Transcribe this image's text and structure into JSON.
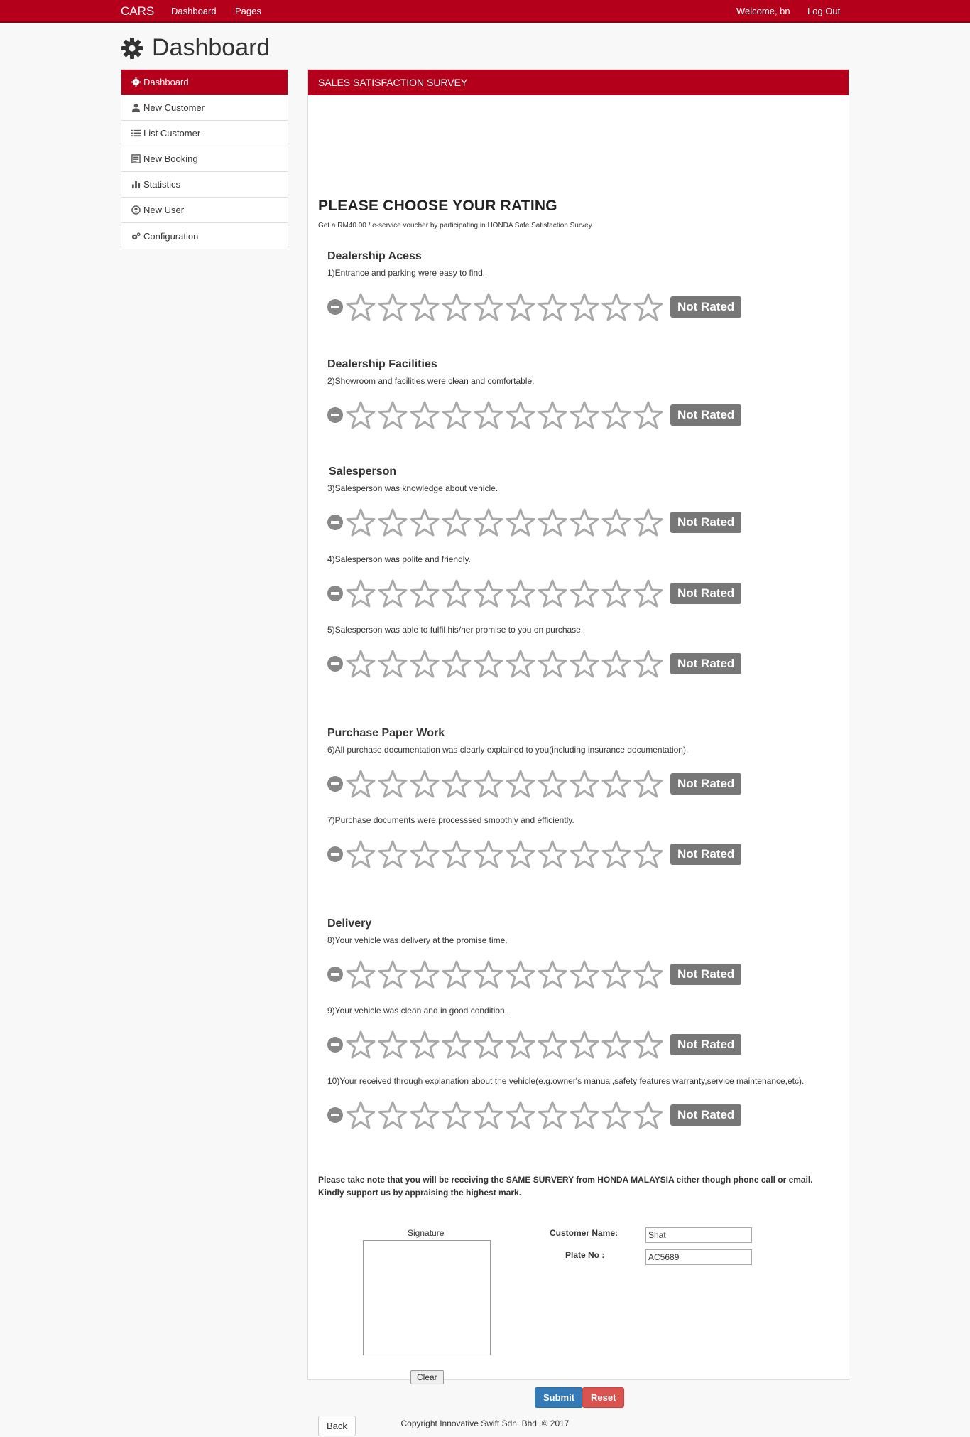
{
  "topbar": {
    "brand": "CARS",
    "nav_dashboard": "Dashboard",
    "nav_pages": "Pages",
    "welcome": "Welcome, bn",
    "logout": "Log Out"
  },
  "page_title": "Dashboard",
  "sidebar": {
    "items": [
      {
        "label": "Dashboard",
        "icon": "gear-icon"
      },
      {
        "label": "New Customer",
        "icon": "user-icon"
      },
      {
        "label": "List Customer",
        "icon": "list-icon"
      },
      {
        "label": "New Booking",
        "icon": "booking-icon"
      },
      {
        "label": "Statistics",
        "icon": "chart-icon"
      },
      {
        "label": "New User",
        "icon": "user-circle-icon"
      },
      {
        "label": "Configuration",
        "icon": "gears-icon"
      }
    ]
  },
  "survey": {
    "panel_title": "SALES SATISFACTION SURVEY",
    "heading": "PLEASE CHOOSE YOUR RATING",
    "subtext": "Get a RM40.00 / e-service voucher by participating in HONDA Safe Satisfaction Survey.",
    "not_rated": "Not Rated",
    "max_stars": 10,
    "sections": [
      {
        "title": "Dealership Acess"
      },
      {
        "title": "Dealership Facilities"
      },
      {
        "title": "Salesperson"
      },
      {
        "title": "Purchase Paper Work"
      },
      {
        "title": "Delivery"
      }
    ],
    "questions": [
      {
        "text": "1)Entrance and parking were easy to find.",
        "rating": 0,
        "status": "Not Rated"
      },
      {
        "text": "2)Showroom and facilities were clean and comfortable.",
        "rating": 0,
        "status": "Not Rated"
      },
      {
        "text": "3)Salesperson was knowledge about vehicle.",
        "rating": 0,
        "status": "Not Rated"
      },
      {
        "text": "4)Salesperson was polite and friendly.",
        "rating": 0,
        "status": "Not Rated"
      },
      {
        "text": "5)Salesperson was able to fulfil his/her promise to you on purchase.",
        "rating": 0,
        "status": "Not Rated"
      },
      {
        "text": "6)All purchase documentation was clearly explained to you(including insurance documentation).",
        "rating": 0,
        "status": "Not Rated"
      },
      {
        "text": "7)Purchase documents were processsed smoothly and efficiently.",
        "rating": 0,
        "status": "Not Rated"
      },
      {
        "text": "8)Your vehicle was delivery at the promise time.",
        "rating": 0,
        "status": "Not Rated"
      },
      {
        "text": "9)Your vehicle was clean and in good condition.",
        "rating": 0,
        "status": "Not Rated"
      },
      {
        "text": "10)Your received through explanation about the vehicle(e.g.owner's manual,safety features warranty,service maintenance,etc).",
        "rating": 0,
        "status": "Not Rated"
      }
    ],
    "note_line1": "Please take note that you will be receiving the SAME SURVERY from HONDA MALAYSIA either though phone call or email.",
    "note_line2": "Kindly support us by appraising the highest mark.",
    "signature_label": "Signature",
    "clear_label": "Clear",
    "customer_name_label": "Customer Name:",
    "customer_name_value": "Shat",
    "plate_no_label": "Plate No :",
    "plate_no_value": "AC5689",
    "submit_label": "Submit",
    "reset_label": "Reset",
    "back_label": "Back"
  },
  "footer": "Copyright Innovative Swift Sdn. Bhd. © 2017"
}
